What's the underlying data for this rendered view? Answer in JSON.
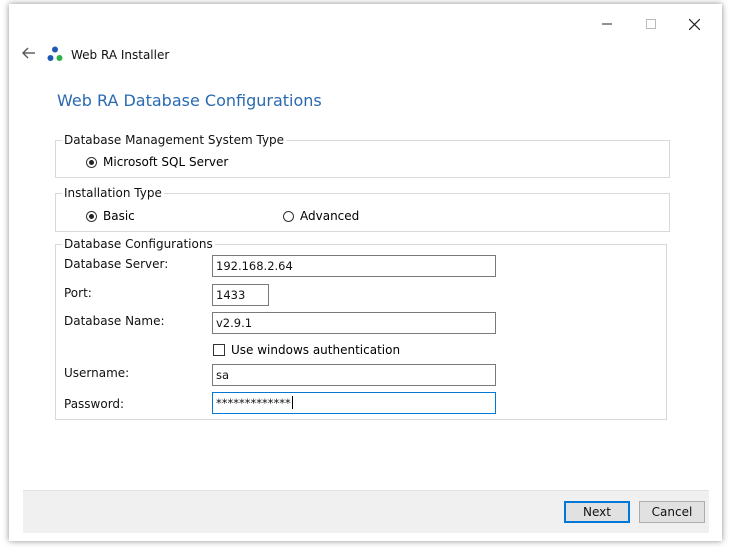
{
  "app": {
    "name": "Web RA Installer"
  },
  "page": {
    "title": "Web RA Database Configurations"
  },
  "dbms_group": {
    "label": "Database Management System Type",
    "options": [
      {
        "label": "Microsoft SQL Server",
        "checked": true
      }
    ]
  },
  "install_group": {
    "label": "Installation Type",
    "options": [
      {
        "label": "Basic",
        "checked": true
      },
      {
        "label": "Advanced",
        "checked": false
      }
    ]
  },
  "config_group": {
    "label": "Database Configurations",
    "server": {
      "label": "Database Server:",
      "value": "192.168.2.64"
    },
    "port": {
      "label": "Port:",
      "value": "1433"
    },
    "db_name": {
      "label": "Database Name:",
      "value": "v2.9.1"
    },
    "windows_auth": {
      "label": "Use windows authentication",
      "checked": false
    },
    "username": {
      "label": "Username:",
      "value": "sa"
    },
    "password": {
      "label": "Password:",
      "value": "*************"
    }
  },
  "footer": {
    "next_label": "Next",
    "cancel_label": "Cancel"
  },
  "colors": {
    "accent": "#0078d7",
    "title": "#2a6ab0",
    "footer_bg": "#f0f0f0"
  },
  "icons": {
    "back": "back-arrow-icon",
    "logo": "app-logo-icon",
    "minimize": "minimize-icon",
    "maximize": "maximize-icon",
    "close": "close-icon"
  }
}
